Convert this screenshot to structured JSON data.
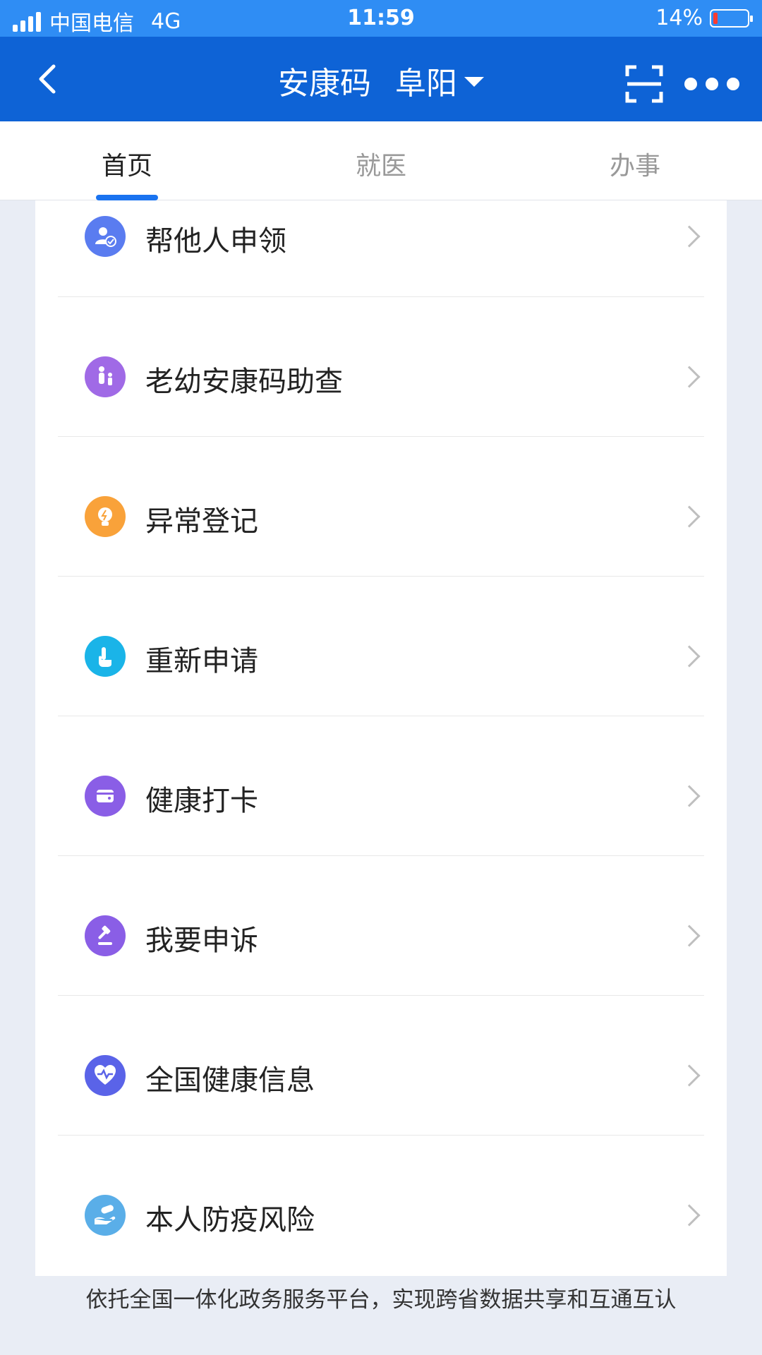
{
  "status_bar": {
    "carrier": "中国电信",
    "network": "4G",
    "time": "11:59",
    "battery": "14%",
    "battery_level": 0.14
  },
  "navbar": {
    "title": "安康码",
    "city": "阜阳"
  },
  "tabs": [
    {
      "label": "首页",
      "active": true
    },
    {
      "label": "就医",
      "active": false
    },
    {
      "label": "办事",
      "active": false
    }
  ],
  "list": [
    {
      "label": "帮他人申领",
      "icon": "user-check-icon",
      "color": "#5a7cf0"
    },
    {
      "label": "老幼安康码助查",
      "icon": "family-icon",
      "color": "#a06ae6"
    },
    {
      "label": "异常登记",
      "icon": "lightbulb-icon",
      "color": "#f9a23a"
    },
    {
      "label": "重新申请",
      "icon": "tap-hand-icon",
      "color": "#1ab4e8"
    },
    {
      "label": "健康打卡",
      "icon": "wallet-icon",
      "color": "#8a5ee6"
    },
    {
      "label": "我要申诉",
      "icon": "gavel-icon",
      "color": "#8a5ee6"
    },
    {
      "label": "全国健康信息",
      "icon": "heart-pulse-icon",
      "color": "#5a63e8"
    },
    {
      "label": "本人防疫风险",
      "icon": "hand-capsule-icon",
      "color": "#5aaee8"
    }
  ],
  "footer": {
    "text": "依托全国一体化政务服务平台，实现跨省数据共享和互通互认"
  }
}
